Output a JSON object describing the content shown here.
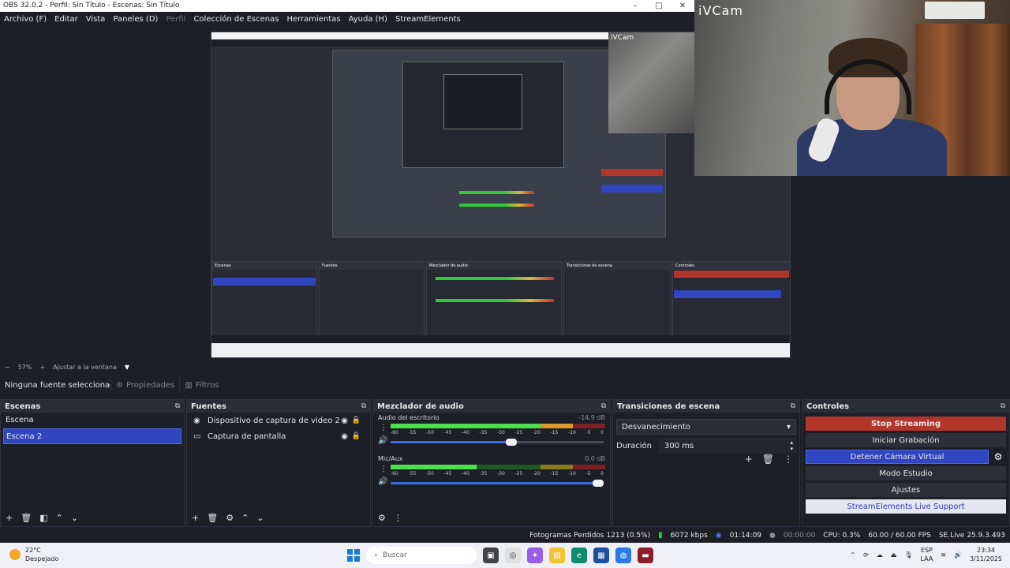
{
  "window": {
    "title": "OBS 32.0.2 - Perfil: Sin Título - Escenas: Sin Título"
  },
  "menu": {
    "items": [
      "Archivo (F)",
      "Editar",
      "Vista",
      "Paneles (D)",
      "Perfil",
      "Colección de Escenas",
      "Herramientas",
      "Ayuda (H)",
      "StreamElements"
    ]
  },
  "camera": {
    "label": "iVCam"
  },
  "zoom": {
    "level": "57%",
    "fit": "Ajustar a la ventana"
  },
  "properties_bar": {
    "no_source": "Ninguna fuente seleccionada",
    "properties": "Propiedades",
    "filters": "Filtros"
  },
  "scenes": {
    "title": "Escenas",
    "items": [
      "Escena",
      "Escena 2"
    ],
    "selected": "Escena 2"
  },
  "sources": {
    "title": "Fuentes",
    "items": [
      {
        "label": "Dispositivo de captura de video 2",
        "icon": "camera-icon"
      },
      {
        "label": "Captura de pantalla",
        "icon": "monitor-icon"
      }
    ]
  },
  "mixer": {
    "title": "Mezclador de audio",
    "tracks": [
      {
        "name": "Audio del escritorio",
        "db": "-14.9 dB"
      },
      {
        "name": "Mic/Aux",
        "db": "0.0 dB"
      }
    ],
    "ticks": [
      "-60",
      "-55",
      "-50",
      "-45",
      "-40",
      "-35",
      "-30",
      "-25",
      "-20",
      "-15",
      "-10",
      "-5",
      "0"
    ]
  },
  "transitions": {
    "title": "Transiciones de escena",
    "selected": "Desvanecimiento",
    "duration_label": "Duración",
    "duration_value": "300 ms"
  },
  "controls": {
    "title": "Controles",
    "stop_streaming": "Stop Streaming",
    "start_recording": "Iniciar Grabación",
    "virtual_cam": "Detener Cámara Virtual",
    "studio_mode": "Modo Estudio",
    "settings": "Ajustes",
    "se_support": "StreamElements Live Support"
  },
  "status": {
    "dropped_frames": "Fotogramas Perdidos 1213 (0.5%)",
    "bitrate": "6072 kbps",
    "stream_time": "01:14:09",
    "rec_time": "00:00:00",
    "cpu": "CPU: 0.3%",
    "fps": "60.00 / 60.00 FPS",
    "se_version": "SE.Live 25.9.3.493"
  },
  "taskbar": {
    "weather_temp": "22°C",
    "weather_desc": "Despejado",
    "search_placeholder": "Buscar",
    "lang_top": "ESP",
    "lang_bottom": "LAA",
    "time": "23:34",
    "date": "3/11/2025"
  },
  "colors": {
    "stop_red": "#b1352b",
    "accent_blue": "#2f46c0",
    "meter_green": "#4be14c"
  }
}
